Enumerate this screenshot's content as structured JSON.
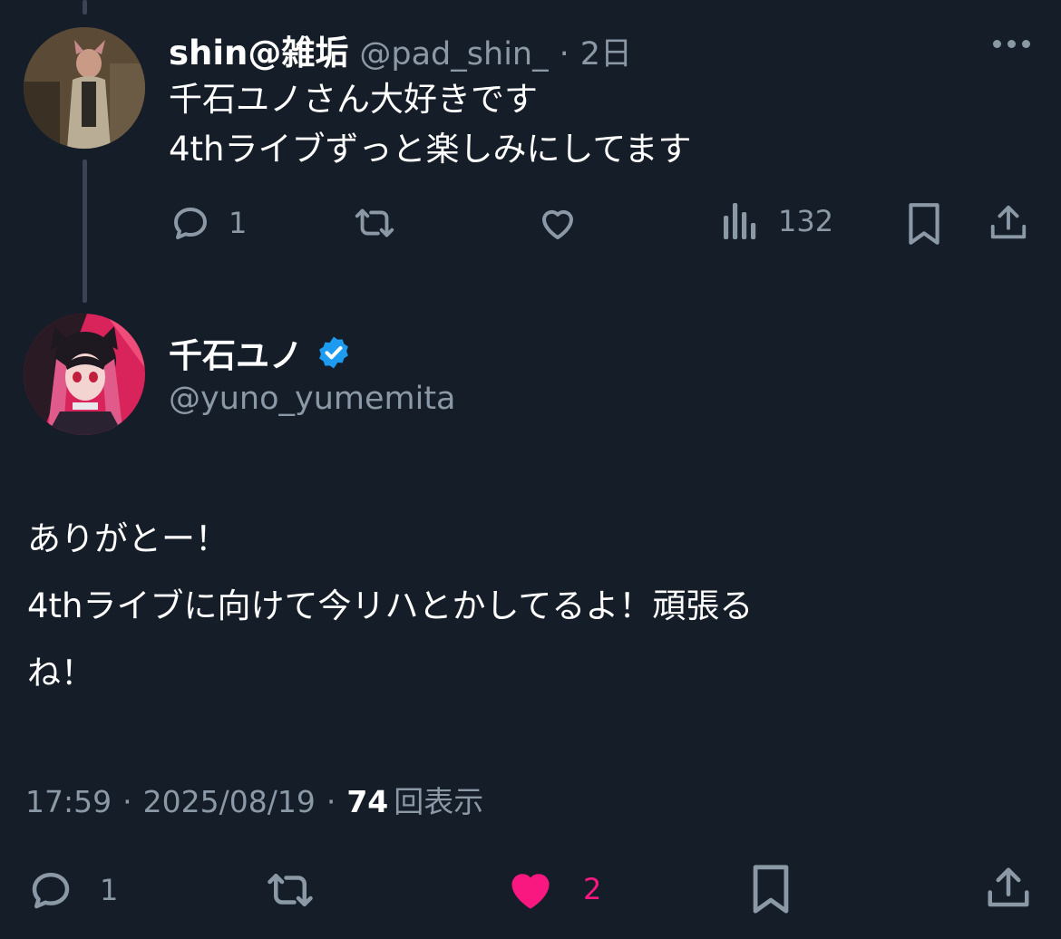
{
  "reply_tweet": {
    "display_name": "shin@雑垢",
    "handle": "@pad_shin_",
    "separator": "·",
    "time_ago": "2日",
    "text_lines": [
      "千石ユノさん大好きです",
      "4thライブずっと楽しみにしてます"
    ],
    "actions": {
      "replies": "1",
      "retweets": "",
      "likes": "",
      "views": "132"
    },
    "icons": {
      "more": "more-icon",
      "reply": "reply-icon",
      "retweet": "retweet-icon",
      "like": "heart-icon",
      "views": "views-icon",
      "bookmark": "bookmark-icon",
      "share": "share-icon"
    }
  },
  "main_tweet": {
    "display_name": "千石ユノ",
    "verified": true,
    "handle": "@yuno_yumemita",
    "text_lines": [
      "ありがとー！",
      "4thライブに向けて今リハとかしてるよ！頑張る",
      "ね！"
    ],
    "time": "17:59",
    "date": "2025/08/19",
    "dot": "·",
    "views_count": "74",
    "views_label": "回表示",
    "actions": {
      "replies": "1",
      "retweets": "",
      "likes": "2",
      "liked": true
    }
  },
  "colors": {
    "background": "#151d28",
    "muted": "#8b98a5",
    "verified_blue": "#1d9bf0",
    "like_pink": "#f91880"
  }
}
